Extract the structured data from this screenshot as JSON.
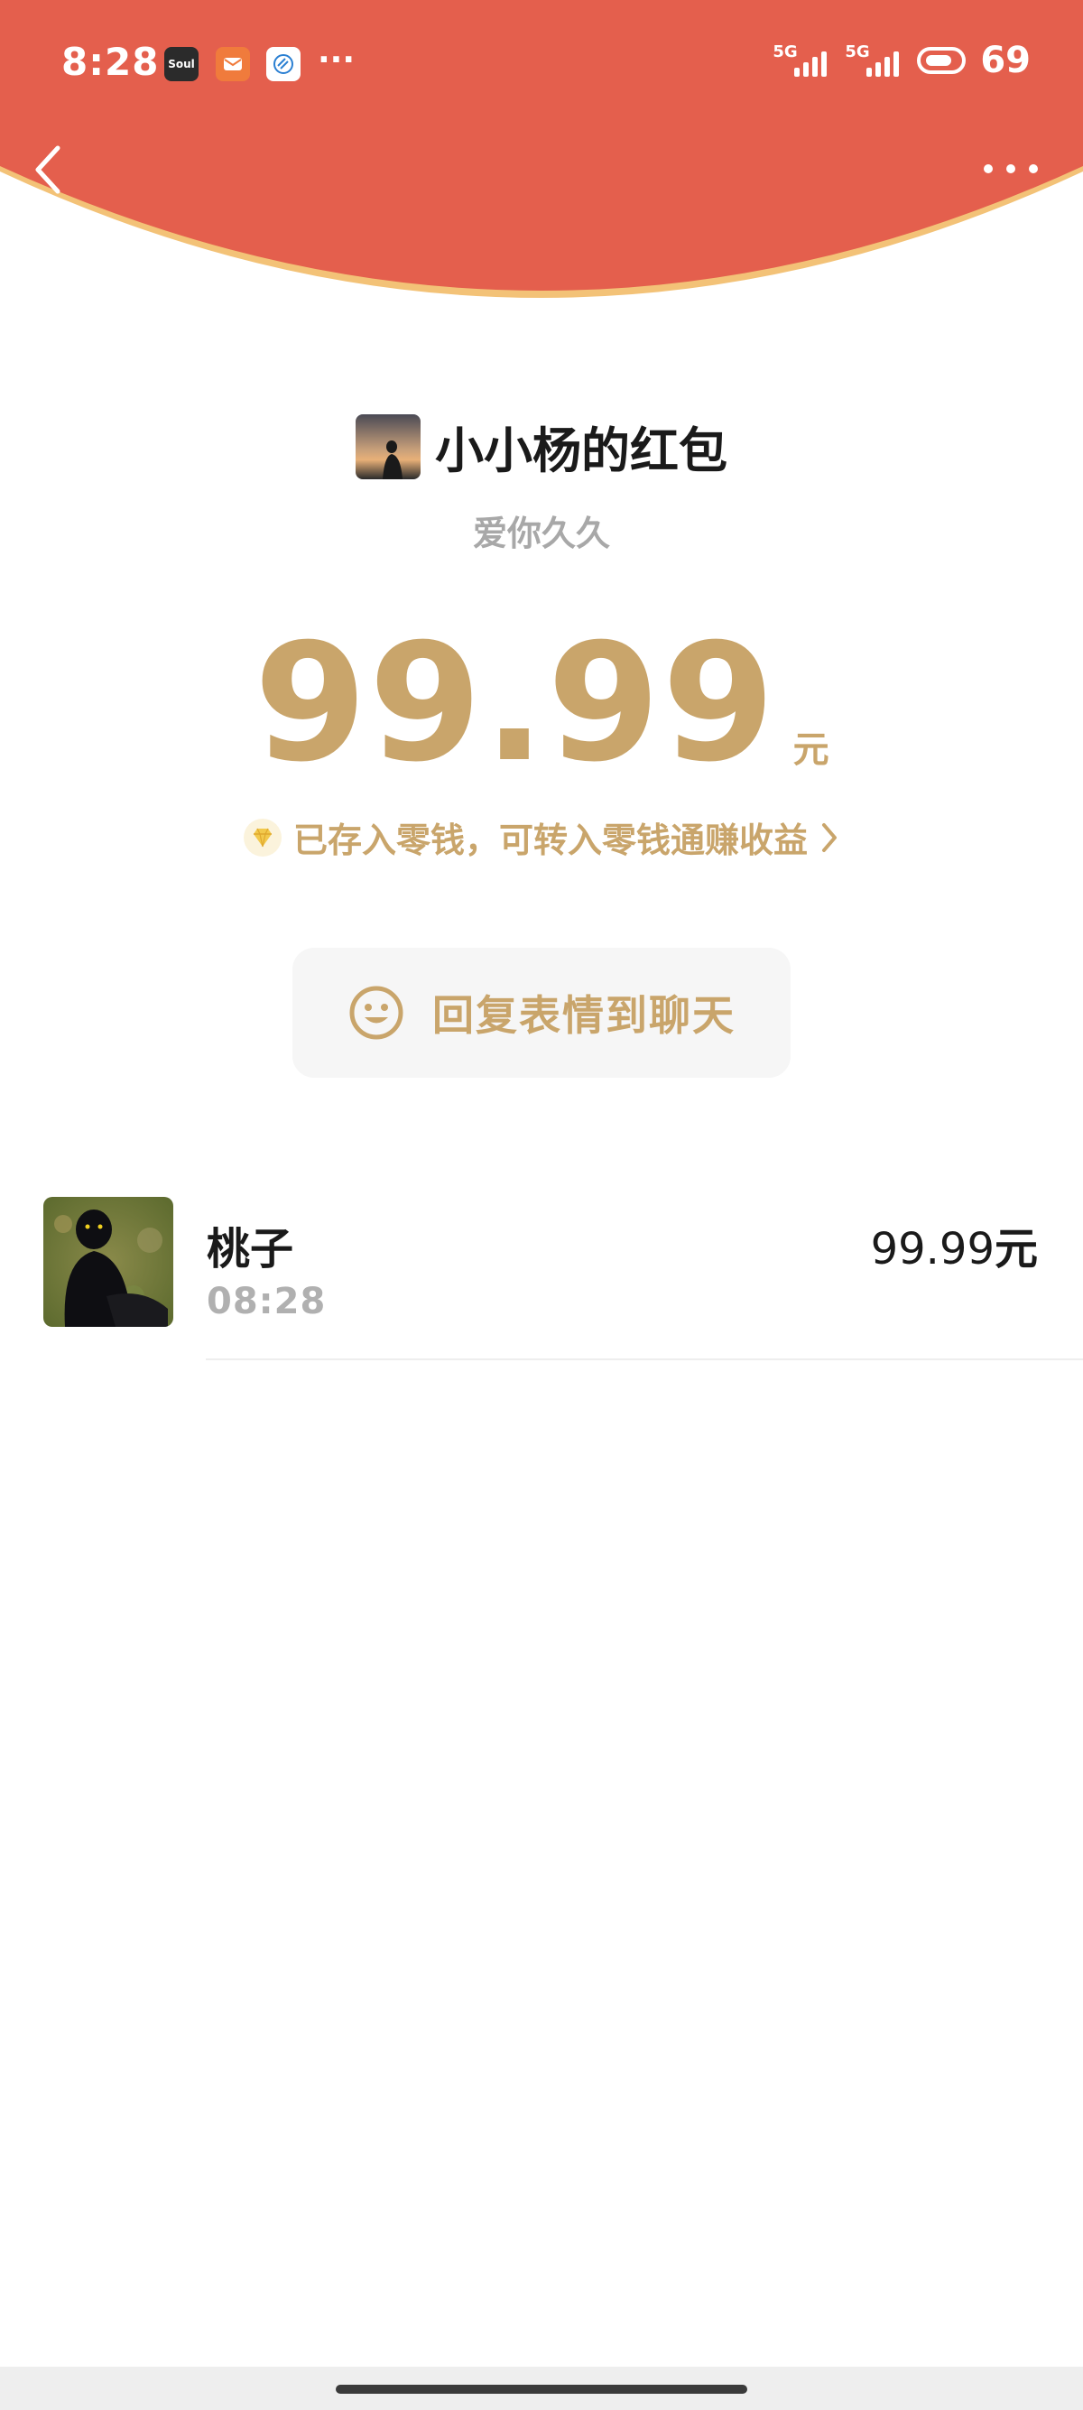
{
  "status_bar": {
    "time": "8:28",
    "apps": [
      "Soul",
      "mail-app",
      "browser-app"
    ],
    "soul_label": "Soul",
    "more": "···",
    "signal1": "5G",
    "signal2": "5G",
    "battery": "69"
  },
  "nav": {
    "back_icon": "chevron-left-icon",
    "more_icon": "more-dots-icon"
  },
  "packet": {
    "sender_title": "小小杨的红包",
    "greeting": "爱你久久",
    "amount": "99.99",
    "unit": "元",
    "deposit_text": "已存入零钱，可转入零钱通赚收益",
    "reply_label": "回复表情到聊天"
  },
  "receivers": [
    {
      "name": "桃子",
      "time": "08:28",
      "amount": "99.99",
      "unit": "元"
    }
  ],
  "colors": {
    "header_red": "#e45f4d",
    "gold": "#c9a56b",
    "arc_edge": "#f3c277"
  }
}
